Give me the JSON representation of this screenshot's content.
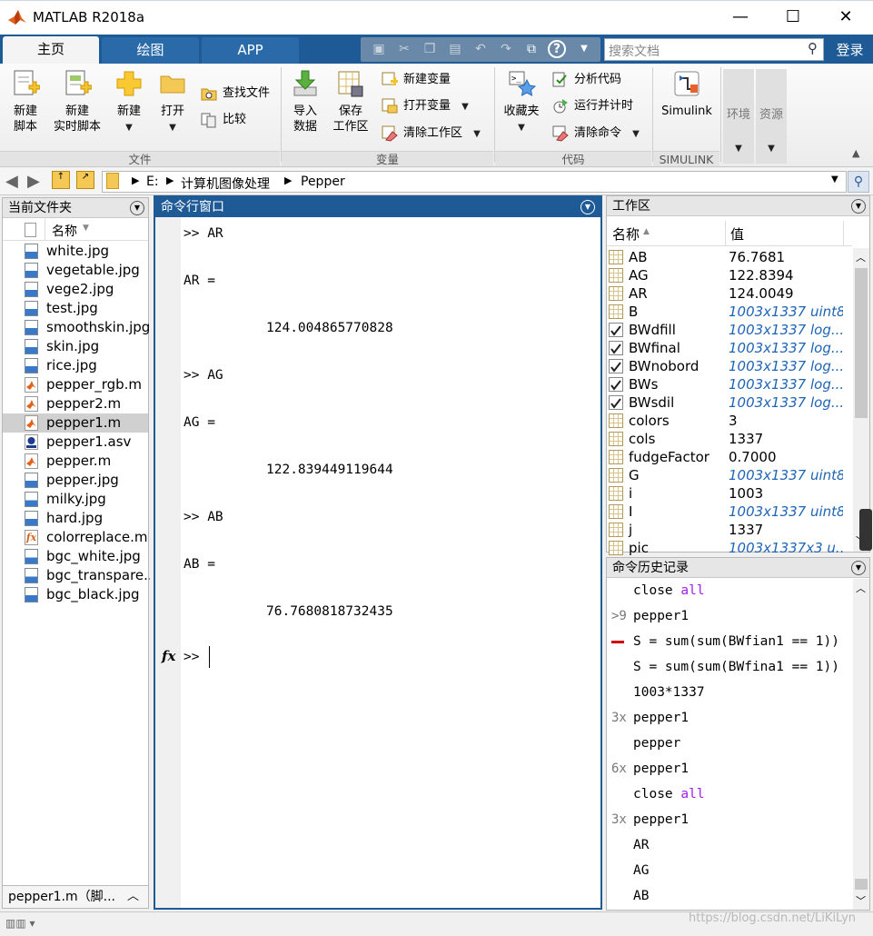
{
  "window": {
    "title": "MATLAB R2018a",
    "minimize": "—",
    "maximize": "☐",
    "close": "✕"
  },
  "tabs": [
    {
      "label": "主页"
    },
    {
      "label": "绘图"
    },
    {
      "label": "APP"
    }
  ],
  "search": {
    "placeholder": "搜索文档"
  },
  "login_label": "登录",
  "ribbon": {
    "file_group": {
      "label": "文件",
      "new_script": "新建\n脚本",
      "new_live_script": "新建\n实时脚本",
      "new": "新建",
      "open": "打开",
      "find_files": "查找文件",
      "compare": "比较"
    },
    "variable_group": {
      "label": "变量",
      "import_data": "导入\n数据",
      "save_workspace": "保存\n工作区",
      "new_variable": "新建变量",
      "open_variable": "打开变量",
      "clear_workspace": "清除工作区"
    },
    "code_group": {
      "label": "代码",
      "favorites": "收藏夹",
      "analyze_code": "分析代码",
      "run_and_time": "运行并计时",
      "clear_commands": "清除命令"
    },
    "simulink_group": {
      "label": "SIMULINK",
      "simulink": "Simulink"
    },
    "environment": "环境",
    "resources": "资源"
  },
  "path": {
    "drive": "E:",
    "folder1": "计算机图像处理",
    "folder2": "Pepper"
  },
  "file_panel": {
    "title": "当前文件夹",
    "column_name": "名称",
    "files": [
      {
        "name": "white.jpg",
        "type": "jpg"
      },
      {
        "name": "vegetable.jpg",
        "type": "jpg"
      },
      {
        "name": "vege2.jpg",
        "type": "jpg"
      },
      {
        "name": "test.jpg",
        "type": "jpg"
      },
      {
        "name": "smoothskin.jpg",
        "type": "jpg"
      },
      {
        "name": "skin.jpg",
        "type": "jpg"
      },
      {
        "name": "rice.jpg",
        "type": "jpg"
      },
      {
        "name": "pepper_rgb.m",
        "type": "m"
      },
      {
        "name": "pepper2.m",
        "type": "m"
      },
      {
        "name": "pepper1.m",
        "type": "m",
        "selected": true
      },
      {
        "name": "pepper1.asv",
        "type": "asv"
      },
      {
        "name": "pepper.m",
        "type": "m"
      },
      {
        "name": "pepper.jpg",
        "type": "jpg"
      },
      {
        "name": "milky.jpg",
        "type": "jpg"
      },
      {
        "name": "hard.jpg",
        "type": "jpg"
      },
      {
        "name": "colorreplace.m",
        "type": "fx"
      },
      {
        "name": "bgc_white.jpg",
        "type": "jpg"
      },
      {
        "name": "bgc_transpare..",
        "type": "jpg"
      },
      {
        "name": "bgc_black.jpg",
        "type": "jpg"
      }
    ],
    "status": "pepper1.m（脚..."
  },
  "command_window": {
    "title": "命令行窗口",
    "lines": [
      {
        "text": ">> AR",
        "indent": false
      },
      {
        "text": "AR =",
        "indent": false
      },
      {
        "text": "124.004865770828",
        "indent": true
      },
      {
        "text": ">> AG",
        "indent": false
      },
      {
        "text": "AG =",
        "indent": false
      },
      {
        "text": "122.839449119644",
        "indent": true
      },
      {
        "text": ">> AB",
        "indent": false
      },
      {
        "text": "AB =",
        "indent": false
      },
      {
        "text": "76.7680818732435",
        "indent": true
      }
    ],
    "prompt": ">>",
    "fx_label": "fx"
  },
  "workspace": {
    "title": "工作区",
    "col_name": "名称",
    "col_value": "值",
    "rows": [
      {
        "name": "AB",
        "value": "76.7681",
        "kind": "num"
      },
      {
        "name": "AG",
        "value": "122.8394",
        "kind": "num"
      },
      {
        "name": "AR",
        "value": "124.0049",
        "kind": "num"
      },
      {
        "name": "B",
        "value": "1003x1337 uint8",
        "kind": "array"
      },
      {
        "name": "BWdfill",
        "value": "1003x1337 log...",
        "kind": "logical"
      },
      {
        "name": "BWfinal",
        "value": "1003x1337 log...",
        "kind": "logical"
      },
      {
        "name": "BWnobord",
        "value": "1003x1337 log...",
        "kind": "logical"
      },
      {
        "name": "BWs",
        "value": "1003x1337 log...",
        "kind": "logical"
      },
      {
        "name": "BWsdil",
        "value": "1003x1337 log...",
        "kind": "logical"
      },
      {
        "name": "colors",
        "value": "3",
        "kind": "num"
      },
      {
        "name": "cols",
        "value": "1337",
        "kind": "num"
      },
      {
        "name": "fudgeFactor",
        "value": "0.7000",
        "kind": "num"
      },
      {
        "name": "G",
        "value": "1003x1337 uint8",
        "kind": "array"
      },
      {
        "name": "i",
        "value": "1003",
        "kind": "num"
      },
      {
        "name": "I",
        "value": "1003x1337 uint8",
        "kind": "array"
      },
      {
        "name": "j",
        "value": "1337",
        "kind": "num"
      },
      {
        "name": "pic",
        "value": "1003x1337x3 u...",
        "kind": "array"
      }
    ]
  },
  "history": {
    "title": "命令历史记录",
    "rows": [
      {
        "marker": "",
        "parts": [
          {
            "t": "close ",
            "k": false
          },
          {
            "t": "all",
            "k": true
          }
        ]
      },
      {
        "marker": ">9",
        "parts": [
          {
            "t": "pepper1",
            "k": false
          }
        ]
      },
      {
        "marker": "err",
        "parts": [
          {
            "t": "S = sum(sum(BWfian1 == 1))",
            "k": false
          }
        ]
      },
      {
        "marker": "",
        "parts": [
          {
            "t": "S = sum(sum(BWfina1 == 1))",
            "k": false
          }
        ]
      },
      {
        "marker": "",
        "parts": [
          {
            "t": "1003*1337",
            "k": false
          }
        ]
      },
      {
        "marker": "3x",
        "parts": [
          {
            "t": "pepper1",
            "k": false
          }
        ]
      },
      {
        "marker": "",
        "parts": [
          {
            "t": "pepper",
            "k": false
          }
        ]
      },
      {
        "marker": "6x",
        "parts": [
          {
            "t": "pepper1",
            "k": false
          }
        ]
      },
      {
        "marker": "",
        "parts": [
          {
            "t": "close ",
            "k": false
          },
          {
            "t": "all",
            "k": true
          }
        ]
      },
      {
        "marker": "3x",
        "parts": [
          {
            "t": "pepper1",
            "k": false
          }
        ]
      },
      {
        "marker": "",
        "parts": [
          {
            "t": "AR",
            "k": false
          }
        ]
      },
      {
        "marker": "",
        "parts": [
          {
            "t": "AG",
            "k": false
          }
        ]
      },
      {
        "marker": "",
        "parts": [
          {
            "t": "AB",
            "k": false
          }
        ]
      }
    ]
  },
  "watermark": "https://blog.csdn.net/LiKiLyn",
  "colors": {
    "accent": "#1e5a96",
    "keyword": "#a020f0",
    "workspace_italic": "#1e64b4",
    "error_marker": "#cc0000"
  }
}
